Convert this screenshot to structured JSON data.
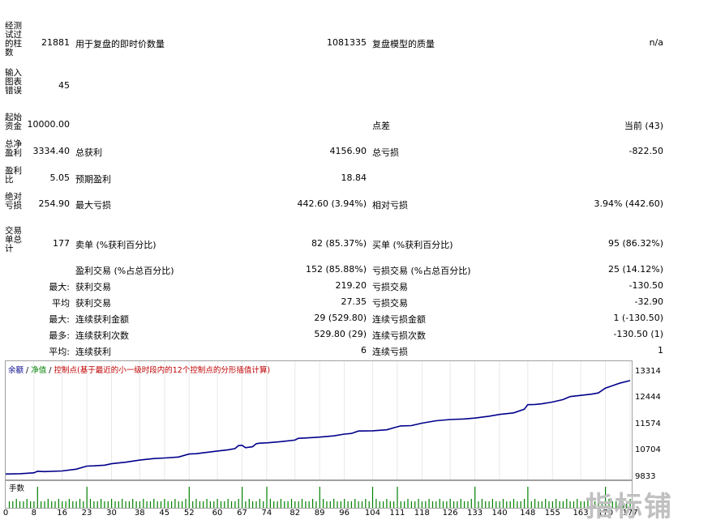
{
  "stats": {
    "bars_label": "经测试过的柱数",
    "bars_value": "21881",
    "ticks_label": "用于复盘的即时价数量",
    "ticks_value": "1081335",
    "quality_label": "复盘模型的质量",
    "quality_value": "n/a",
    "errors_label": "输入图表错误",
    "errors_value": "45",
    "deposit_label": "起始资金",
    "deposit_value": "10000.00",
    "spread_label": "点差",
    "spread_value": "当前 (43)",
    "net_label": "总净盈利",
    "net_value": "3334.40",
    "gross_profit_label": "总获利",
    "gross_profit_value": "4156.90",
    "gross_loss_label": "总亏损",
    "gross_loss_value": "-822.50",
    "pf_label": "盈利比",
    "pf_value": "5.05",
    "expected_label": "预期盈利",
    "expected_value": "18.84",
    "abs_dd_label": "绝对亏损",
    "abs_dd_value": "254.90",
    "max_dd_label": "最大亏损",
    "max_dd_value": "442.60 (3.94%)",
    "rel_dd_label": "相对亏损",
    "rel_dd_value": "3.94% (442.60)",
    "trades_label": "交易单总计",
    "trades_value": "177",
    "short_label": "卖单 (%获利百分比)",
    "short_value": "82 (85.37%)",
    "long_label": "买单 (%获利百分比)",
    "long_value": "95 (86.32%)",
    "win_trades_label": "盈利交易 (%占总百分比)",
    "win_trades_value": "152 (85.88%)",
    "loss_trades_label": "亏损交易 (%占总百分比)",
    "loss_trades_value": "25 (14.12%)",
    "largest_prefix": "最大:",
    "largest_win_label": "获利交易",
    "largest_win_value": "219.20",
    "largest_loss_label": "亏损交易",
    "largest_loss_value": "-130.50",
    "avg_prefix": "平均",
    "avg_win_label": "获利交易",
    "avg_win_value": "27.35",
    "avg_loss_label": "亏损交易",
    "avg_loss_value": "-32.90",
    "max_prefix": "最大:",
    "max_cons_win_label": "连续获利金额",
    "max_cons_win_value": "29 (529.80)",
    "max_cons_loss_label": "连续亏损金额",
    "max_cons_loss_value": "1 (-130.50)",
    "most_prefix": "最多:",
    "most_cons_win_label": "连续获利次数",
    "most_cons_win_value": "529.80 (29)",
    "most_cons_loss_label": "连续亏损次数",
    "most_cons_loss_value": "-130.50 (1)",
    "avgc_prefix": "平均:",
    "avg_cons_win_label": "连续获利",
    "avg_cons_win_value": "6",
    "avg_cons_loss_label": "连续亏损",
    "avg_cons_loss_value": "1"
  },
  "legend": {
    "balance": "余额",
    "sep1": " / ",
    "equity": "净值",
    "sep2": " / ",
    "points": "控制点(基于最近的小一级时段内的12个控制点的分形插值计算)"
  },
  "volume_label": "手数",
  "watermark": "指标铺",
  "colors": {
    "balance": "#00008b",
    "equity": "#008000",
    "points": "#c00000",
    "volume": "#008000",
    "grid": "#a0a0a0"
  },
  "chart_data": {
    "type": "line",
    "ylim": [
      9833,
      13314
    ],
    "y_ticks": [
      "13314",
      "12444",
      "11574",
      "10704",
      "9833"
    ],
    "x_ticks": [
      "0",
      "8",
      "16",
      "23",
      "30",
      "38",
      "45",
      "52",
      "60",
      "67",
      "74",
      "82",
      "89",
      "96",
      "104",
      "111",
      "118",
      "126",
      "133",
      "140",
      "148",
      "155",
      "163",
      "170",
      "177"
    ],
    "xlim": [
      0,
      177
    ],
    "series": [
      {
        "name": "余额",
        "x": [
          0,
          4,
          8,
          9,
          11,
          16,
          20,
          23,
          25,
          28,
          30,
          34,
          38,
          42,
          45,
          49,
          52,
          54,
          56,
          60,
          63,
          65,
          66,
          67,
          68,
          70,
          71,
          72,
          74,
          78,
          82,
          83,
          85,
          89,
          93,
          96,
          98,
          100,
          104,
          108,
          111,
          112,
          115,
          118,
          122,
          126,
          130,
          133,
          137,
          140,
          144,
          147,
          148,
          150,
          152,
          155,
          158,
          160,
          163,
          166,
          168,
          170,
          172,
          174,
          177
        ],
        "values": [
          9960,
          9970,
          10000,
          10050,
          10040,
          10060,
          10120,
          10220,
          10230,
          10250,
          10300,
          10350,
          10420,
          10470,
          10490,
          10520,
          10620,
          10630,
          10660,
          10720,
          10760,
          10800,
          10900,
          10910,
          10830,
          10860,
          10960,
          10980,
          10990,
          11030,
          11080,
          11140,
          11150,
          11180,
          11220,
          11280,
          11300,
          11380,
          11390,
          11420,
          11520,
          11550,
          11560,
          11640,
          11720,
          11760,
          11780,
          11810,
          11870,
          11930,
          11980,
          12100,
          12250,
          12260,
          12280,
          12340,
          12420,
          12520,
          12560,
          12600,
          12640,
          12800,
          12880,
          12960,
          13050
        ]
      }
    ],
    "volume": {
      "name": "手数",
      "tall_bars_at": [
        9,
        23,
        52,
        67,
        74,
        89,
        104,
        111,
        133,
        148,
        170
      ]
    }
  }
}
